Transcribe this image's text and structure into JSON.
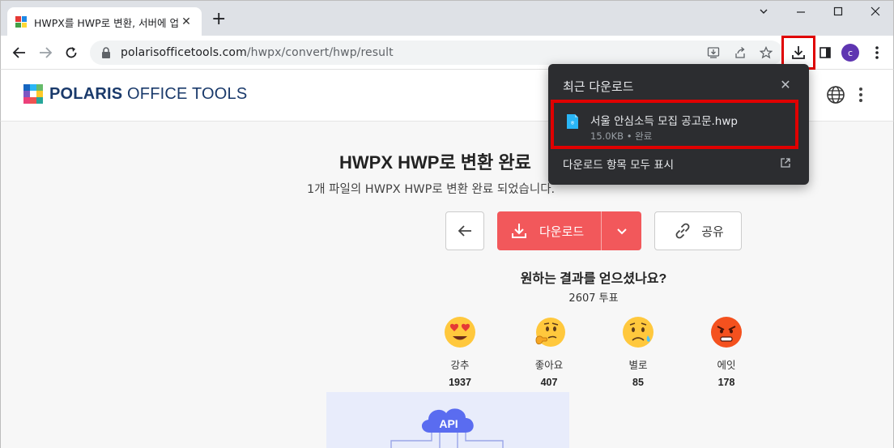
{
  "browser": {
    "tab_title": "HWPX를 HWP로 변환, 서버에 업",
    "url_host": "polarisofficetools.com",
    "url_path": "/hwpx/convert/hwp/result",
    "profile_initial": "c"
  },
  "site": {
    "logo_bold": "POLARIS",
    "logo_rest": " OFFICE TOOLS"
  },
  "main": {
    "title": "HWPX HWP로 변환 완료",
    "subtitle": "1개 파일의 HWPX HWP로 변환 완료 되었습니다.",
    "download_label": "다운로드",
    "share_label": "공유",
    "question": "원하는 결과를 얻으셨나요?",
    "vote_total": "2607 투표",
    "reactions": [
      {
        "label": "강추",
        "count": "1937",
        "icon": "heart-eyes-emoji"
      },
      {
        "label": "좋아요",
        "count": "407",
        "icon": "thinking-emoji"
      },
      {
        "label": "별로",
        "count": "85",
        "icon": "sad-emoji"
      },
      {
        "label": "에잇",
        "count": "178",
        "icon": "angry-emoji"
      }
    ],
    "api_label": "API"
  },
  "downloads_popup": {
    "title": "최근 다운로드",
    "file_name": "서울 안심소득 모집 공고문.hwp",
    "file_meta": "15.0KB • 완료",
    "show_all": "다운로드 항목 모두 표시"
  },
  "colors": {
    "accent_red": "#f2585b",
    "highlight_red": "#e00000",
    "popup_bg": "#2c2d30",
    "logo_navy": "#1a3a6b"
  }
}
